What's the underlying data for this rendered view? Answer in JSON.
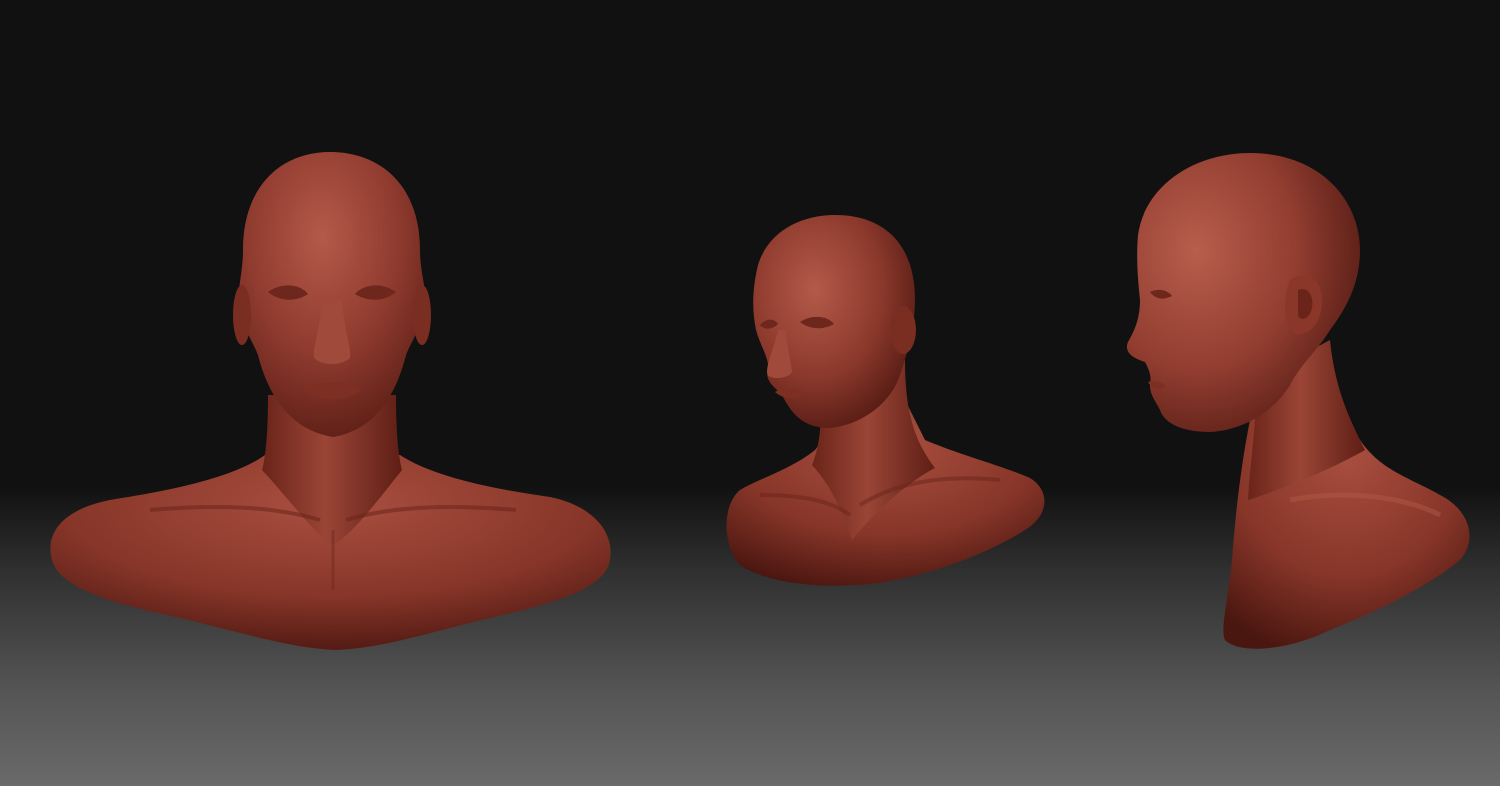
{
  "scene": {
    "views": [
      {
        "view": "front"
      },
      {
        "view": "three-quarter"
      },
      {
        "view": "side"
      }
    ],
    "colors": {
      "clay": "#8e3a2e",
      "clay_light": "#b45a4a",
      "clay_dark": "#4a1610",
      "background_top": "#111111",
      "background_bottom": "#6a6a6a"
    }
  }
}
